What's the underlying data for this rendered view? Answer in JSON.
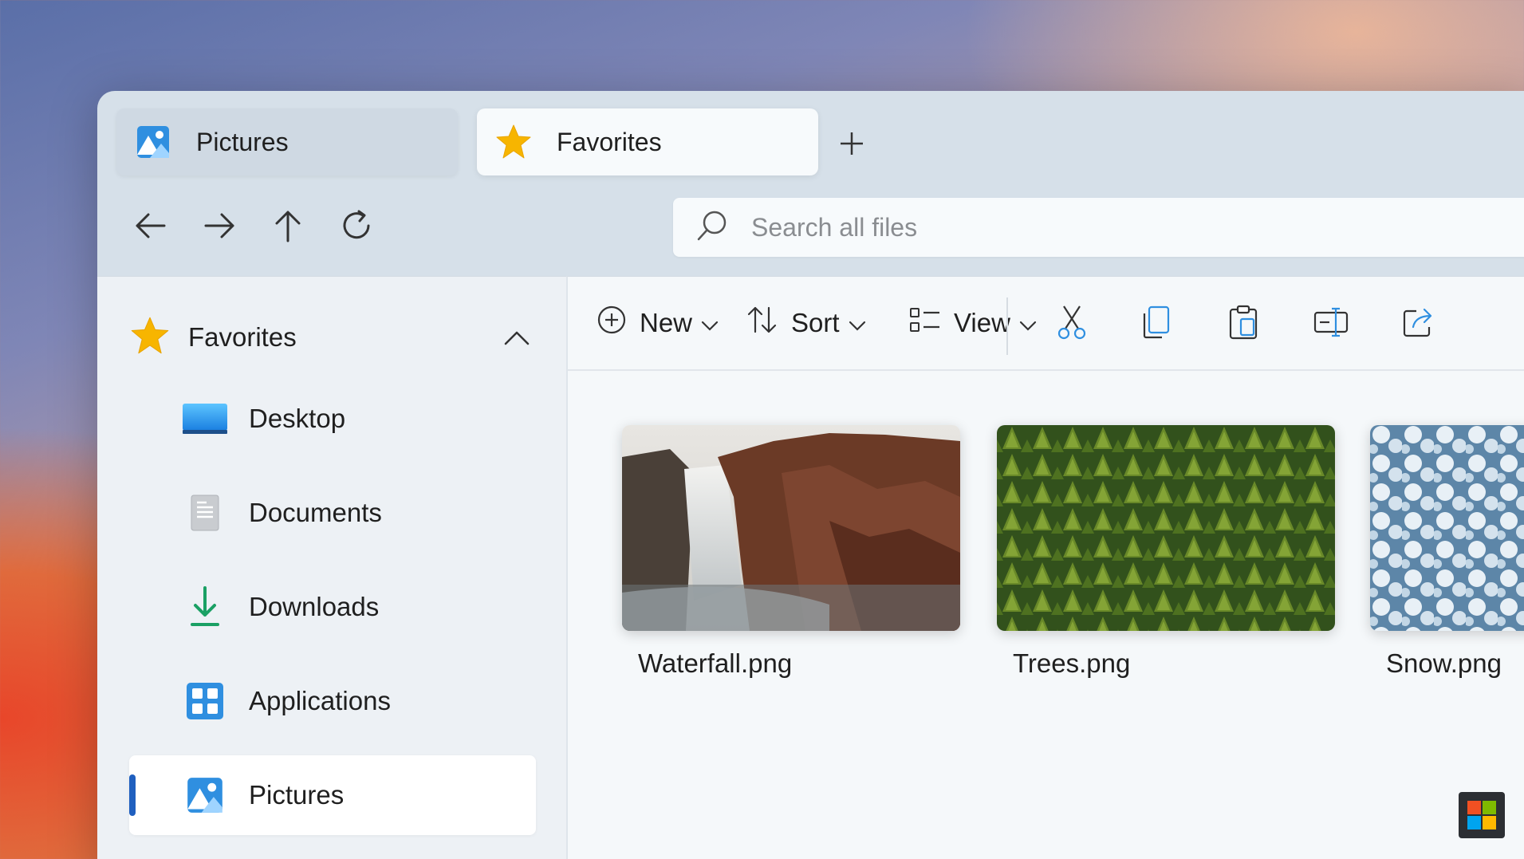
{
  "tabs": [
    {
      "label": "Pictures",
      "icon": "pictures-icon",
      "active": false
    },
    {
      "label": "Favorites",
      "icon": "star-icon",
      "active": true
    }
  ],
  "new_tab_icon": "plus-icon",
  "nav": {
    "back_icon": "arrow-left-icon",
    "forward_icon": "arrow-right-icon",
    "up_icon": "arrow-up-icon",
    "refresh_icon": "refresh-icon"
  },
  "search": {
    "placeholder": "Search all files",
    "value": ""
  },
  "sidebar": {
    "section_label": "Favorites",
    "items": [
      {
        "label": "Desktop",
        "icon": "desktop-icon"
      },
      {
        "label": "Documents",
        "icon": "document-icon"
      },
      {
        "label": "Downloads",
        "icon": "download-icon"
      },
      {
        "label": "Applications",
        "icon": "applications-icon"
      },
      {
        "label": "Pictures",
        "icon": "pictures-icon",
        "selected": true
      }
    ]
  },
  "toolbar": {
    "new_label": "New",
    "sort_label": "Sort",
    "view_label": "View",
    "actions": [
      "cut-icon",
      "copy-icon",
      "paste-icon",
      "rename-icon",
      "share-icon"
    ]
  },
  "files": [
    {
      "name": "Waterfall.png"
    },
    {
      "name": "Trees.png"
    },
    {
      "name": "Snow.png"
    }
  ],
  "colors": {
    "accent": "#1f5fbf",
    "star": "#f7b500",
    "window_bg": "#d6e0e9",
    "sidebar_bg": "#edf1f5",
    "content_bg": "#f5f8fa"
  }
}
